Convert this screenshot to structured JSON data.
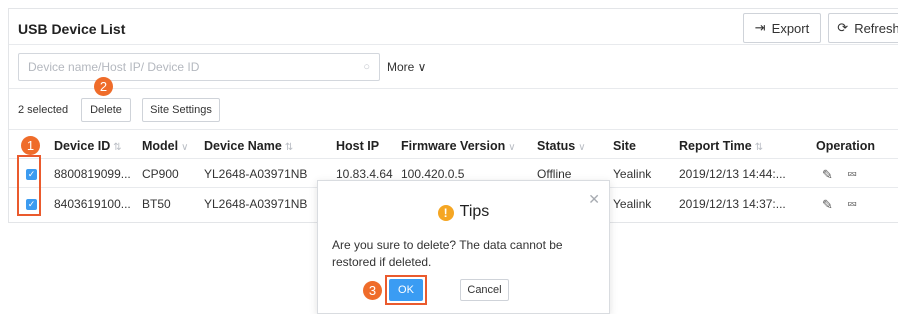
{
  "header": {
    "title": "USB Device List",
    "export_label": "Export",
    "refresh_label": "Refresh"
  },
  "search": {
    "placeholder": "Device name/Host IP/ Device ID",
    "more_label": "More ∨"
  },
  "toolbar": {
    "selected_count": "2 selected",
    "delete_label": "Delete",
    "site_settings_label": "Site Settings"
  },
  "table": {
    "columns": [
      "Device ID",
      "Model",
      "Device Name",
      "Host IP",
      "Firmware Version",
      "Status",
      "Site",
      "Report Time",
      "Operation"
    ],
    "rows": [
      {
        "device_id": "8800819099...",
        "model": "CP900",
        "device_name": "YL2648-A03971NB",
        "host_ip": "10.83.4.64",
        "firmware": "100.420.0.5",
        "status": "Offline",
        "site": "Yealink",
        "report_time": "2019/12/13 14:44:...",
        "checked": true
      },
      {
        "device_id": "8403619100...",
        "model": "BT50",
        "device_name": "YL2648-A03971NB",
        "host_ip": "",
        "firmware": "",
        "status": "",
        "site": "Yealink",
        "report_time": "2019/12/13 14:37:...",
        "checked": true
      }
    ]
  },
  "dialog": {
    "title": "Tips",
    "message": "Are you sure to delete? The data cannot be restored if deleted.",
    "ok_label": "OK",
    "cancel_label": "Cancel"
  },
  "callouts": {
    "step1": "1",
    "step2": "2",
    "step3": "3"
  },
  "colors": {
    "accent": "#3a9cf3",
    "callout": "#ef6c2a",
    "warning": "#f5a623"
  }
}
